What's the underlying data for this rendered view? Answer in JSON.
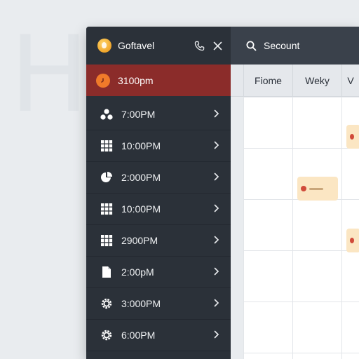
{
  "window": {
    "app_name": "Goftavel"
  },
  "sidebar": {
    "active_item": {
      "label": "3100pm",
      "icon": "clock-icon"
    },
    "items": [
      {
        "label": "7:00PM",
        "icon": "group-icon"
      },
      {
        "label": "10:00PM",
        "icon": "grid-icon"
      },
      {
        "label": "2:000PM",
        "icon": "chart-icon"
      },
      {
        "label": "10:00PM",
        "icon": "grid-icon"
      },
      {
        "label": "2900PM",
        "icon": "grid-icon"
      },
      {
        "label": "2:00pM",
        "icon": "document-icon"
      },
      {
        "label": "3:000PM",
        "icon": "gear-icon"
      },
      {
        "label": "6:00PM",
        "icon": "gear-icon"
      }
    ]
  },
  "topbar": {
    "search_label": "Secount"
  },
  "tabs": [
    {
      "label": "Fiome"
    },
    {
      "label": "Weky"
    },
    {
      "label": "V"
    }
  ],
  "colors": {
    "sidebar_bg": "#2b3139",
    "active_bg": "#8b2c2a",
    "active_icon": "#f07a2a",
    "event_bg": "#fbe6c3",
    "event_dot": "#d04a3a"
  }
}
